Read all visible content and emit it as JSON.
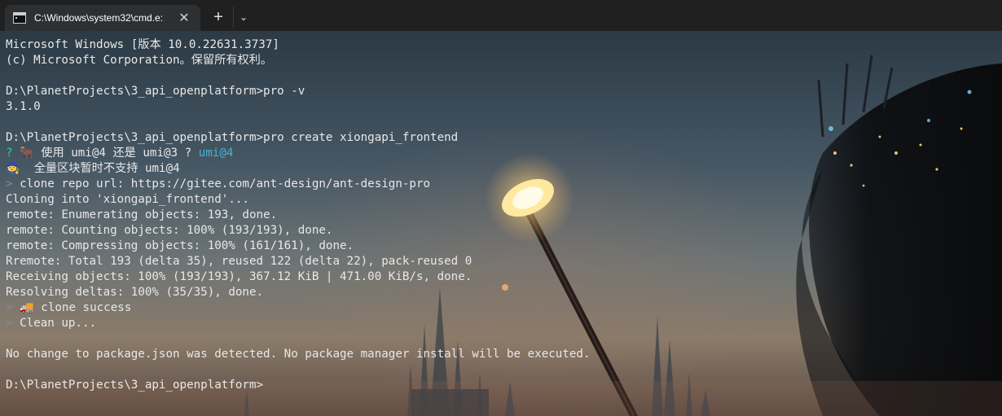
{
  "window": {
    "tab_title": "C:\\Windows\\system32\\cmd.e:",
    "tab_close": "✕",
    "new_tab": "+",
    "dropdown": "⌄"
  },
  "terminal": {
    "lines": [
      {
        "parts": [
          {
            "text": "Microsoft Windows [版本 10.0.22631.3737]",
            "cls": ""
          }
        ]
      },
      {
        "parts": [
          {
            "text": "(c) Microsoft Corporation。保留所有权利。",
            "cls": ""
          }
        ]
      },
      {
        "parts": []
      },
      {
        "parts": [
          {
            "text": "D:\\PlanetProjects\\3_api_openplatform>pro -v",
            "cls": ""
          }
        ]
      },
      {
        "parts": [
          {
            "text": "3.1.0",
            "cls": ""
          }
        ]
      },
      {
        "parts": []
      },
      {
        "parts": [
          {
            "text": "D:\\PlanetProjects\\3_api_openplatform>pro create xiongapi_frontend",
            "cls": ""
          }
        ]
      },
      {
        "parts": [
          {
            "text": "? ",
            "cls": "q"
          },
          {
            "text": "🐂 使用 umi@4 还是 umi@3 ? ",
            "cls": ""
          },
          {
            "text": "umi@4",
            "cls": "ans"
          }
        ]
      },
      {
        "parts": [
          {
            "text": "🧙  全量区块暂时不支持 umi@4",
            "cls": ""
          }
        ]
      },
      {
        "parts": [
          {
            "text": "> ",
            "cls": "gt"
          },
          {
            "text": "clone repo url: https://gitee.com/ant-design/ant-design-pro",
            "cls": ""
          }
        ]
      },
      {
        "parts": [
          {
            "text": "Cloning into 'xiongapi_frontend'...",
            "cls": ""
          }
        ]
      },
      {
        "parts": [
          {
            "text": "remote: Enumerating objects: 193, done.",
            "cls": ""
          }
        ]
      },
      {
        "parts": [
          {
            "text": "remote: Counting objects: 100% (193/193), done.",
            "cls": ""
          }
        ]
      },
      {
        "parts": [
          {
            "text": "remote: Compressing objects: 100% (161/161), done.",
            "cls": ""
          }
        ]
      },
      {
        "parts": [
          {
            "text": "Rremote: Total 193 (delta 35), reused 122 (delta 22), pack-reused 0",
            "cls": ""
          }
        ]
      },
      {
        "parts": [
          {
            "text": "Receiving objects: 100% (193/193), 367.12 KiB | 471.00 KiB/s, done.",
            "cls": ""
          }
        ]
      },
      {
        "parts": [
          {
            "text": "Resolving deltas: 100% (35/35), done.",
            "cls": ""
          }
        ]
      },
      {
        "parts": [
          {
            "text": "> ",
            "cls": "gt"
          },
          {
            "text": "🚚 clone success",
            "cls": ""
          }
        ]
      },
      {
        "parts": [
          {
            "text": "> ",
            "cls": "gt"
          },
          {
            "text": "Clean up...",
            "cls": ""
          }
        ]
      },
      {
        "parts": []
      },
      {
        "parts": [
          {
            "text": "No change to package.json was detected. No package manager install will be executed.",
            "cls": ""
          }
        ]
      },
      {
        "parts": []
      },
      {
        "parts": [
          {
            "text": "D:\\PlanetProjects\\3_api_openplatform>",
            "cls": ""
          }
        ]
      }
    ]
  },
  "colors": {
    "prompt_question": "#23d18b",
    "answer": "#3fb6d6",
    "arrow": "#8a8a8a",
    "text": "#e8e8e8"
  }
}
